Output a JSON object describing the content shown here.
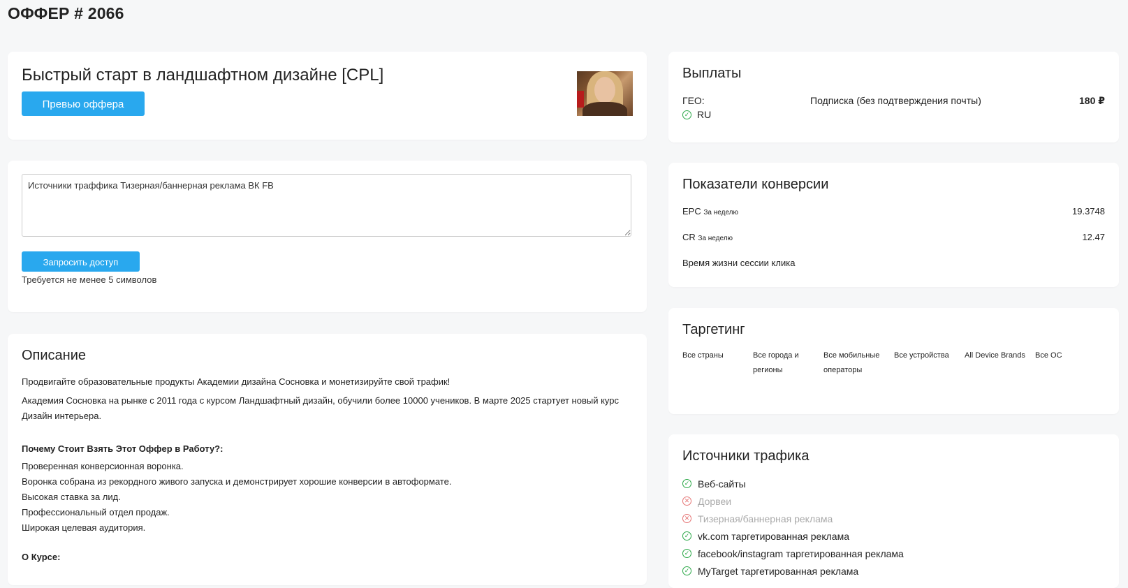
{
  "page": {
    "title": "ОФФЕР # 2066"
  },
  "offer": {
    "name": "Быстрый старт в ландшафтном дизайне [CPL]",
    "preview_button": "Превью оффера"
  },
  "request": {
    "textarea_value": "Источники траффика Тизерная/баннерная реклама ВК FB",
    "button": "Запросить доступ",
    "hint": "Требуется не менее 5 символов"
  },
  "description": {
    "title": "Описание",
    "p1": "Продвигайте образовательные продукты Академии дизайна Сосновка и монетизируйте свой трафик!",
    "p2": "Академия Сосновка на рынке с 2011 года с курсом Ландшафтный дизайн, обучили более 10000 учеников. В марте 2025 стартует новый курс Дизайн интерьера.",
    "why_title": "Почему Стоит Взять Этот Оффер в Работу?:",
    "why_items": [
      "Проверенная конверсионная воронка.",
      "Воронка собрана из рекордного живого запуска и демонстрирует хорошие конверсии в автоформате.",
      "Высокая ставка за лид.",
      "Профессиональный отдел продаж.",
      "Широкая целевая аудитория."
    ],
    "course_title": "О Курсе:"
  },
  "payouts": {
    "title": "Выплаты",
    "geo_label": "ГЕО:",
    "geo_value": "RU",
    "type": "Подписка (без подтверждения почты)",
    "amount": "180 ₽"
  },
  "conversion": {
    "title": "Показатели конверсии",
    "epc_label": "EPC",
    "epc_period": "За неделю",
    "epc_value": "19.3748",
    "cr_label": "CR",
    "cr_period": "За неделю",
    "cr_value": "12.47",
    "session_label": "Время жизни сессии клика"
  },
  "targeting": {
    "title": "Таргетинг",
    "items": [
      "Все страны",
      "Все города и регионы",
      "Все мобильные операторы",
      "Все устройства",
      "All Device Brands",
      "Все ОС"
    ]
  },
  "sources": {
    "title": "Источники трафика",
    "items": [
      {
        "label": "Веб-сайты",
        "allowed": true
      },
      {
        "label": "Дорвеи",
        "allowed": false
      },
      {
        "label": "Тизерная/баннерная реклама",
        "allowed": false
      },
      {
        "label": "vk.com таргетированная реклама",
        "allowed": true
      },
      {
        "label": "facebook/instagram таргетированная реклама",
        "allowed": true
      },
      {
        "label": "MyTarget таргетированная реклама",
        "allowed": true
      }
    ]
  },
  "colors": {
    "accent": "#29a8ee",
    "ok": "#28a745",
    "denied": "#e57373"
  },
  "icons": {
    "allowed": "check-circle-icon",
    "denied": "x-circle-icon"
  }
}
